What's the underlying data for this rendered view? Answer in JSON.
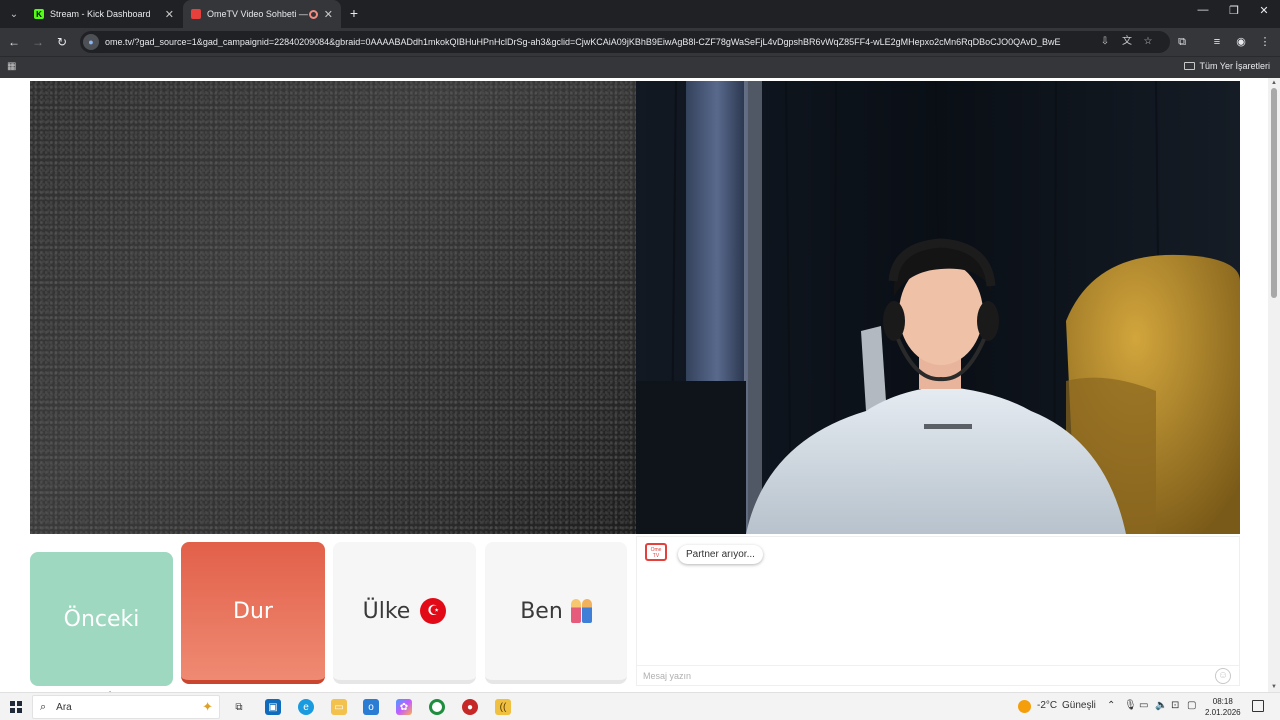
{
  "browser": {
    "tabs": [
      {
        "title": "Stream - Kick Dashboard",
        "active": false
      },
      {
        "title": "OmeTV Video Sohbeti — O",
        "active": true
      }
    ],
    "url": "ome.tv/?gad_source=1&gad_campaignid=22840209084&gbraid=0AAAABADdh1mkokQIBHuHPnHclDrSg-ah3&gclid=CjwKCAiA09jKBhB9EiwAgB8l-CZF78gWaSeFjL4vDgpshBR6vWqZ85FF4-wLE2gMHepxo2cMn6RqDBoCJO0QAvD_BwE",
    "bookmarks_all_label": "Tüm Yer İşaretleri"
  },
  "controls": {
    "prev_label": "Önceki",
    "stop_label": "Dur",
    "country_label": "Ülke",
    "country_flag": "☪",
    "me_label": "Ben"
  },
  "chat": {
    "logo_text": "Ome TV",
    "status_message": "Partner arıyor...",
    "input_placeholder": "Mesaj yazın"
  },
  "taskbar": {
    "search_label": "Ara",
    "weather_temp": "-2°C",
    "weather_desc": "Güneşli",
    "time": "08:18",
    "date": "2.01.2026"
  },
  "colors": {
    "prev_button": "#9fd8c0",
    "stop_button": "#e2604a",
    "accent_red": "#e5403b"
  }
}
